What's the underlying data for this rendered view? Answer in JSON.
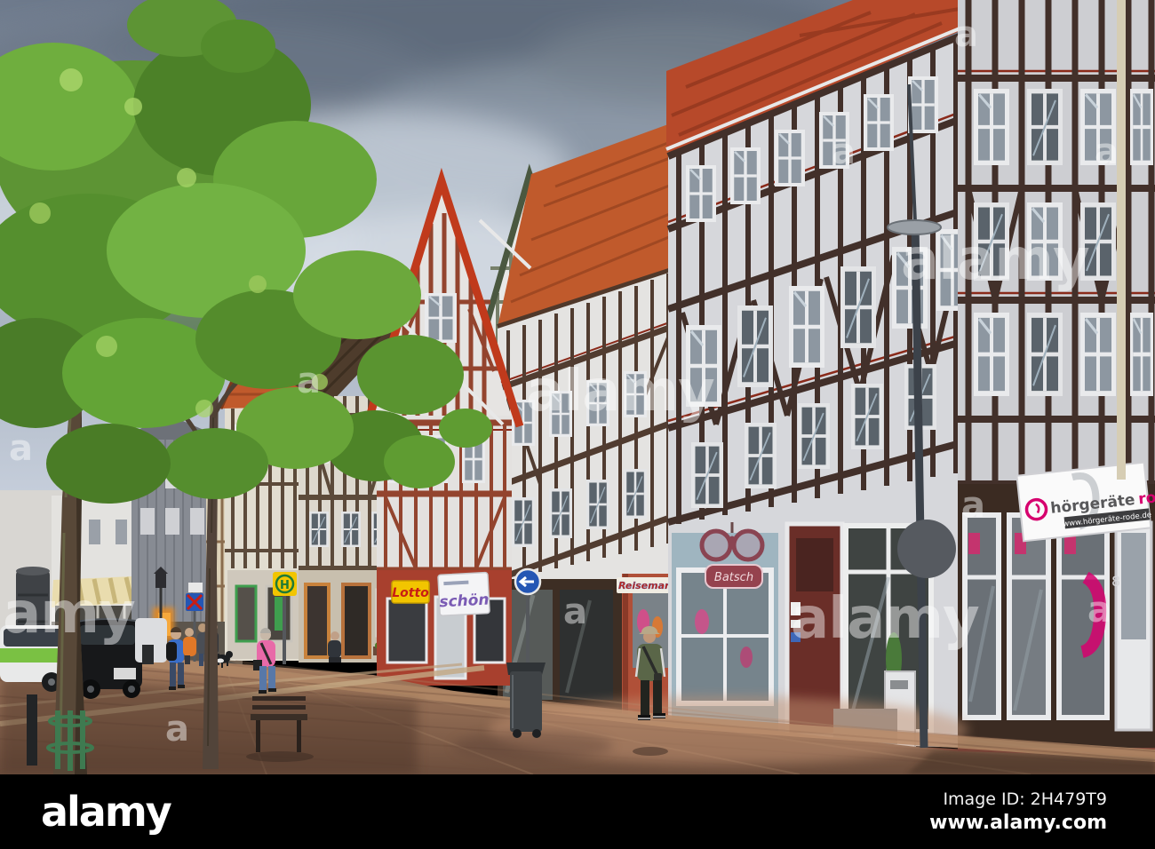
{
  "scene": {
    "description": "Sunlit pedestrian street lined with German half-timbered houses (Fachwerk), red tiled roofs, shop signs, parked cars, pedestrians and a large green tree under a cloudy grey-blue sky"
  },
  "signs": {
    "bus_stop": "H",
    "lotto": "Lotto",
    "salon": "schön",
    "travel": "Reisemarkt",
    "optician": "Batsch",
    "hearing_word1": "hörgeräte",
    "hearing_word2": "rode",
    "hearing_url": "www.hörgeräte-rode.de",
    "house_number": "8"
  },
  "watermarks": {
    "large": "alamy",
    "small": "a"
  },
  "footer": {
    "logo": "alamy",
    "image_id": "Image ID: 2H479T9",
    "website": "www.alamy.com"
  },
  "colors": {
    "sky_top": "#66term7486",
    "sky_light": "#ccd4de",
    "roof_red": "#b7492a",
    "roof_orange": "#c05a2c",
    "timber_dark": "#42302a",
    "timber_red": "#93442e",
    "plaster": "#dcdde1",
    "street_brick": "#8f6a52",
    "accent_pink": "#d6006e",
    "lotto_yellow": "#f2c500",
    "sign_blue": "#2456b4",
    "bargeboard_red": "#c03a1c",
    "bargeboard_green": "#4a5840",
    "foliage_green": "#5d9434"
  }
}
